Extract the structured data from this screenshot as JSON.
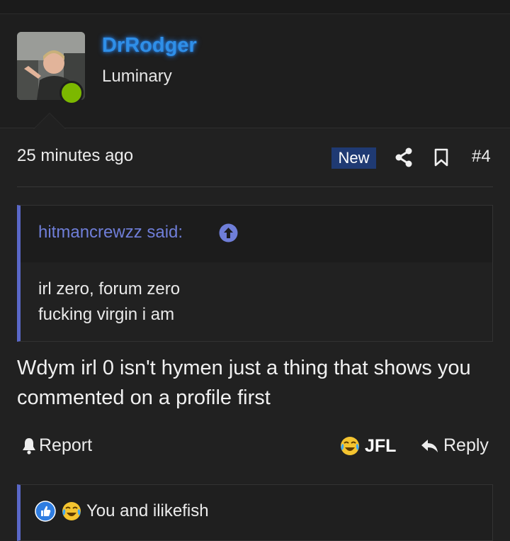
{
  "user": {
    "name": "DrRodger",
    "title": "Luminary",
    "status": "online",
    "name_color": "#2f8fe8"
  },
  "post": {
    "timestamp": "25 minutes ago",
    "badge": "New",
    "number": "#4",
    "quote": {
      "author_line": "hitmancrewzz said:",
      "lines": [
        "irl zero, forum zero",
        "fucking virgin i am"
      ]
    },
    "message": "Wdym irl 0 isn't hymen just a thing that shows you commented on a profile first"
  },
  "actions": {
    "report": "Report",
    "jfl": "JFL",
    "reply": "Reply"
  },
  "reactions": {
    "icons": [
      "like-icon",
      "crying-laughing-icon"
    ],
    "text": "You and ilikefish"
  },
  "colors": {
    "accent": "#5a68c8",
    "badge_bg": "#1f3a73",
    "online": "#7cb800",
    "background": "#212121"
  }
}
